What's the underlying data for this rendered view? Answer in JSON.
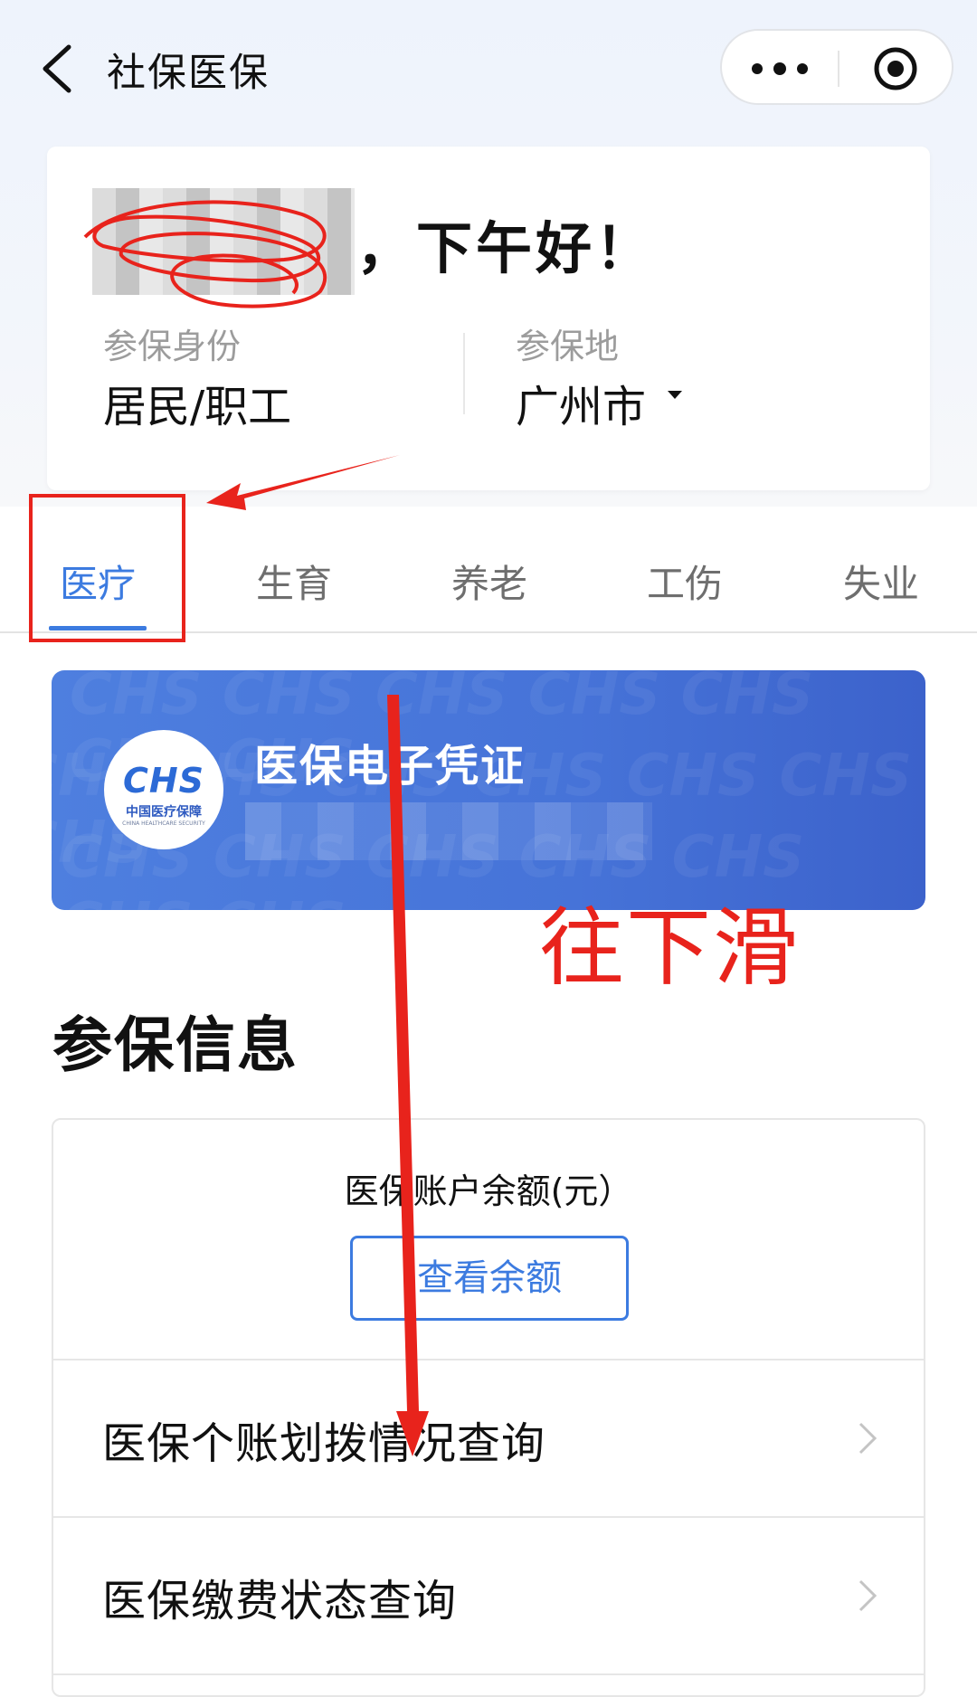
{
  "nav": {
    "title": "社保医保"
  },
  "profile": {
    "greeting": "，下午好！",
    "identity_label": "参保身份",
    "identity_value": "居民/职工",
    "region_label": "参保地",
    "region_value": "广州市"
  },
  "tabs": [
    {
      "label": "医疗",
      "active": true
    },
    {
      "label": "生育",
      "active": false
    },
    {
      "label": "养老",
      "active": false
    },
    {
      "label": "工伤",
      "active": false
    },
    {
      "label": "失业",
      "active": false
    }
  ],
  "voucher": {
    "title": "医保电子凭证",
    "logo_mark": "CHS",
    "logo_cn": "中国医疗保障",
    "logo_en": "CHINA HEALTHCARE SECURITY"
  },
  "annotation": {
    "text": "往下滑"
  },
  "section": {
    "title": "参保信息"
  },
  "info_card": {
    "balance_label": "医保账户余额(元）",
    "balance_button": "查看余额",
    "rows": [
      {
        "label": "医保个账划拨情况查询"
      },
      {
        "label": "医保缴费状态查询"
      }
    ]
  },
  "colors": {
    "accent": "#3c7be0",
    "annotation_red": "#e8231c",
    "voucher_blue": "#4673d8"
  }
}
